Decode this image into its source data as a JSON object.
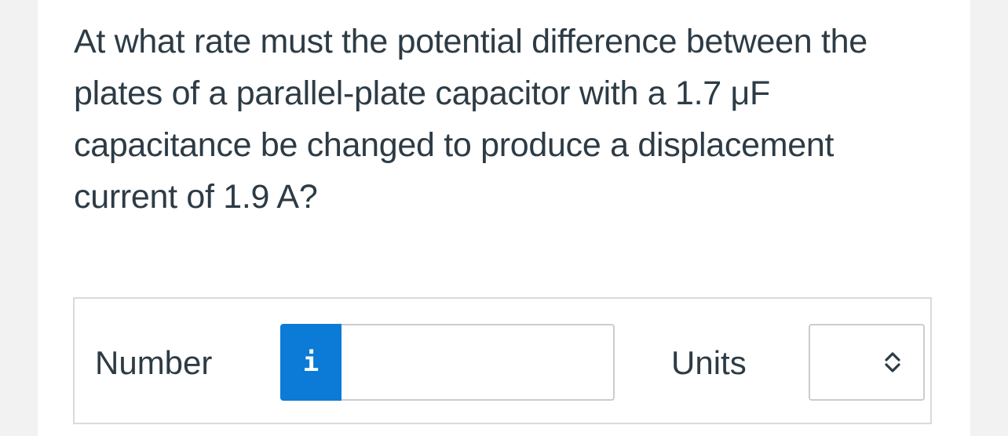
{
  "question": {
    "text": "At what rate must the potential difference between the plates of a parallel-plate capacitor with a 1.7 μF capacitance be changed to produce a displacement current of 1.9 A?"
  },
  "answer": {
    "number_label": "Number",
    "info_icon": "info-icon",
    "info_glyph": "i",
    "number_value": "",
    "units_label": "Units",
    "units_selected": "",
    "select_icon": "up-down-chevron-icon"
  },
  "colors": {
    "text": "#2d3b45",
    "info_button": "#0b7bd7",
    "border": "#c9cdd1"
  }
}
